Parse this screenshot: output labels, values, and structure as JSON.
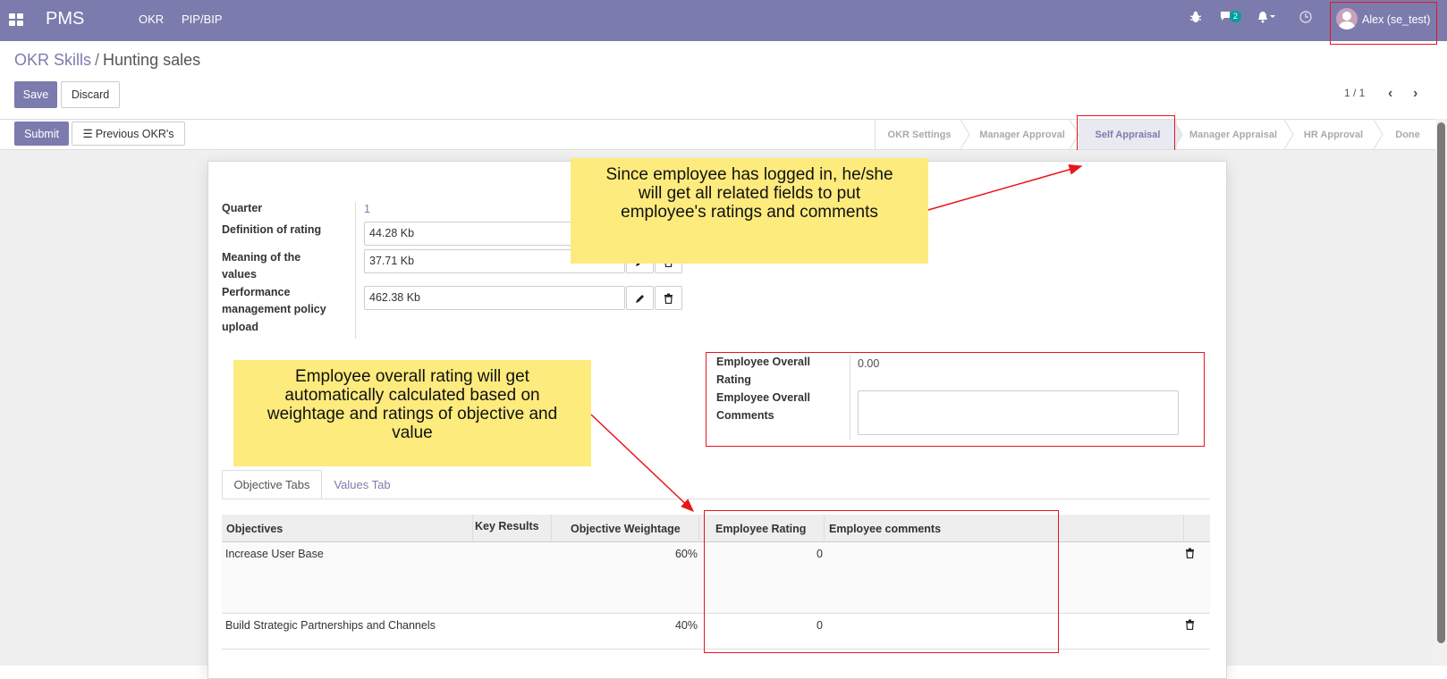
{
  "navbar": {
    "brand": "PMS",
    "menu": [
      "OKR",
      "PIP/BIP"
    ],
    "chat_count": "2",
    "user": "Alex (se_test)"
  },
  "breadcrumb": {
    "parent": "OKR Skills",
    "separator": "/",
    "current": "Hunting sales"
  },
  "buttons": {
    "save": "Save",
    "discard": "Discard",
    "submit": "Submit",
    "previous_okrs": "Previous OKR's"
  },
  "pager": "1 / 1",
  "stages": [
    "OKR Settings",
    "Manager Approval",
    "Self Appraisal",
    "Manager Appraisal",
    "HR Approval",
    "Done"
  ],
  "active_stage": "Self Appraisal",
  "form": {
    "quarter_label": "Quarter",
    "quarter_value": "1",
    "definition_label": "Definition of rating",
    "definition_value": "44.28 Kb",
    "meaning_label_1": "Meaning of the",
    "meaning_label_2": "values",
    "meaning_value": "37.71 Kb",
    "policy_label_1": "Performance",
    "policy_label_2": "management policy",
    "policy_label_3": "upload",
    "policy_value": "462.38 Kb",
    "overall_rating_label_1": "Employee Overall",
    "overall_rating_label_2": "Rating",
    "overall_rating_value": "0.00",
    "overall_comments_label_1": "Employee Overall",
    "overall_comments_label_2": "Comments",
    "overall_comments_value": ""
  },
  "notes": {
    "top": [
      "Since employee has logged in, he/she",
      "will get all related fields to put",
      "employee's ratings and comments"
    ],
    "left": [
      "Employee overall rating will get",
      "automatically calculated based on",
      "weightage and ratings of objective and",
      "value"
    ]
  },
  "tabs": [
    "Objective Tabs",
    "Values Tab"
  ],
  "table": {
    "columns": [
      "Objectives",
      "Key Results",
      "Objective Weightage",
      "Employee Rating",
      "Employee comments"
    ],
    "rows": [
      {
        "objective": "Increase User Base",
        "key_results": "",
        "weightage": "60%",
        "rating": "0",
        "comments": ""
      },
      {
        "objective": "Build Strategic Partnerships and Channels",
        "key_results": "",
        "weightage": "40%",
        "rating": "0",
        "comments": ""
      }
    ]
  },
  "colors": {
    "brand": "#7c7bad",
    "note": "#fdeb7d",
    "highlight": "#e8161b"
  }
}
